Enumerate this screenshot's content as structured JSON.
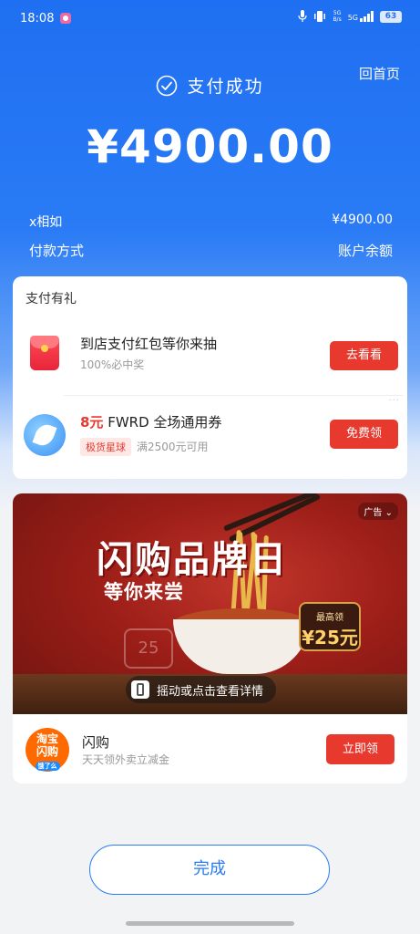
{
  "status_bar": {
    "time": "18:08",
    "network_upper": "5G",
    "network_lower": "B/s",
    "network_type": "5G",
    "battery": "63"
  },
  "header": {
    "home_link": "回首页",
    "success_text": "支付成功",
    "amount": "¥4900.00"
  },
  "payment_info": {
    "payee": "x相如",
    "payee_amount": "¥4900.00",
    "method_label": "付款方式",
    "method_value": "账户余额"
  },
  "gift": {
    "title": "支付有礼",
    "items": [
      {
        "title": "到店支付红包等你来抽",
        "sub": "100%必中奖",
        "button": "去看看"
      },
      {
        "amount_prefix": "8元",
        "title": "FWRD 全场通用券",
        "tag": "极货星球",
        "sub": "满2500元可用",
        "button": "免费领"
      }
    ]
  },
  "ad": {
    "tag": "广告",
    "banner_title": "闪购品牌日",
    "banner_sub": "等你来尝",
    "coupon_top": "最高领",
    "coupon_value": "¥25元",
    "ghost_value": "25",
    "shake_text": "摇动或点击查看详情",
    "logo_line1": "淘宝",
    "logo_line2": "闪购",
    "logo_small": "饿了么",
    "name": "闪购",
    "sub": "天天领外卖立减金",
    "button": "立即领"
  },
  "footer": {
    "done_label": "完成"
  },
  "colors": {
    "primary_blue": "#2a7bf5",
    "button_red": "#e8392f"
  }
}
